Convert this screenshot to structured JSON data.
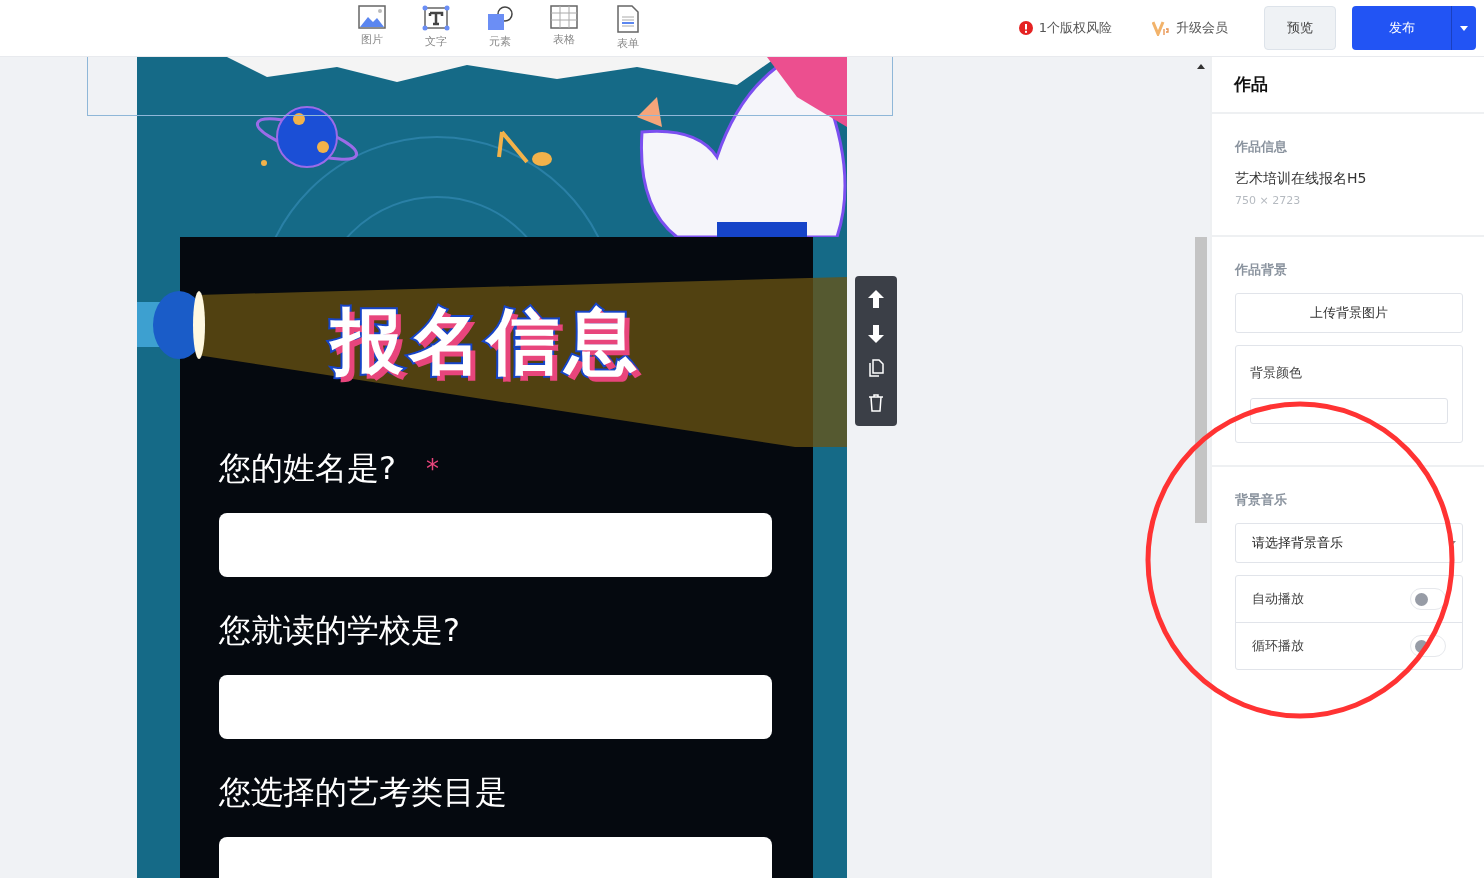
{
  "toolbar": {
    "tools": [
      {
        "kind": "image",
        "label": "图片"
      },
      {
        "kind": "text",
        "label": "文字"
      },
      {
        "kind": "shape",
        "label": "元素"
      },
      {
        "kind": "table",
        "label": "表格"
      },
      {
        "kind": "form",
        "label": "表单"
      }
    ],
    "risk": "1个版权风险",
    "upgrade": "升级会员",
    "preview": "预览",
    "publish": "发布"
  },
  "canvas": {
    "title": "报名信息",
    "fields": [
      {
        "label": "您的姓名是?",
        "required_mark": "*"
      },
      {
        "label": "您就读的学校是?"
      },
      {
        "label": "您选择的艺考类目是"
      }
    ]
  },
  "panel": {
    "title": "作品",
    "info": {
      "heading": "作品信息",
      "name": "艺术培训在线报名H5",
      "size": "750 × 2723"
    },
    "background": {
      "heading": "作品背景",
      "upload": "上传背景图片",
      "color_label": "背景颜色"
    },
    "music": {
      "heading": "背景音乐",
      "placeholder": "请选择背景音乐",
      "toggles": [
        {
          "label": "自动播放",
          "on": false
        },
        {
          "label": "循环播放",
          "on": false
        }
      ]
    }
  }
}
